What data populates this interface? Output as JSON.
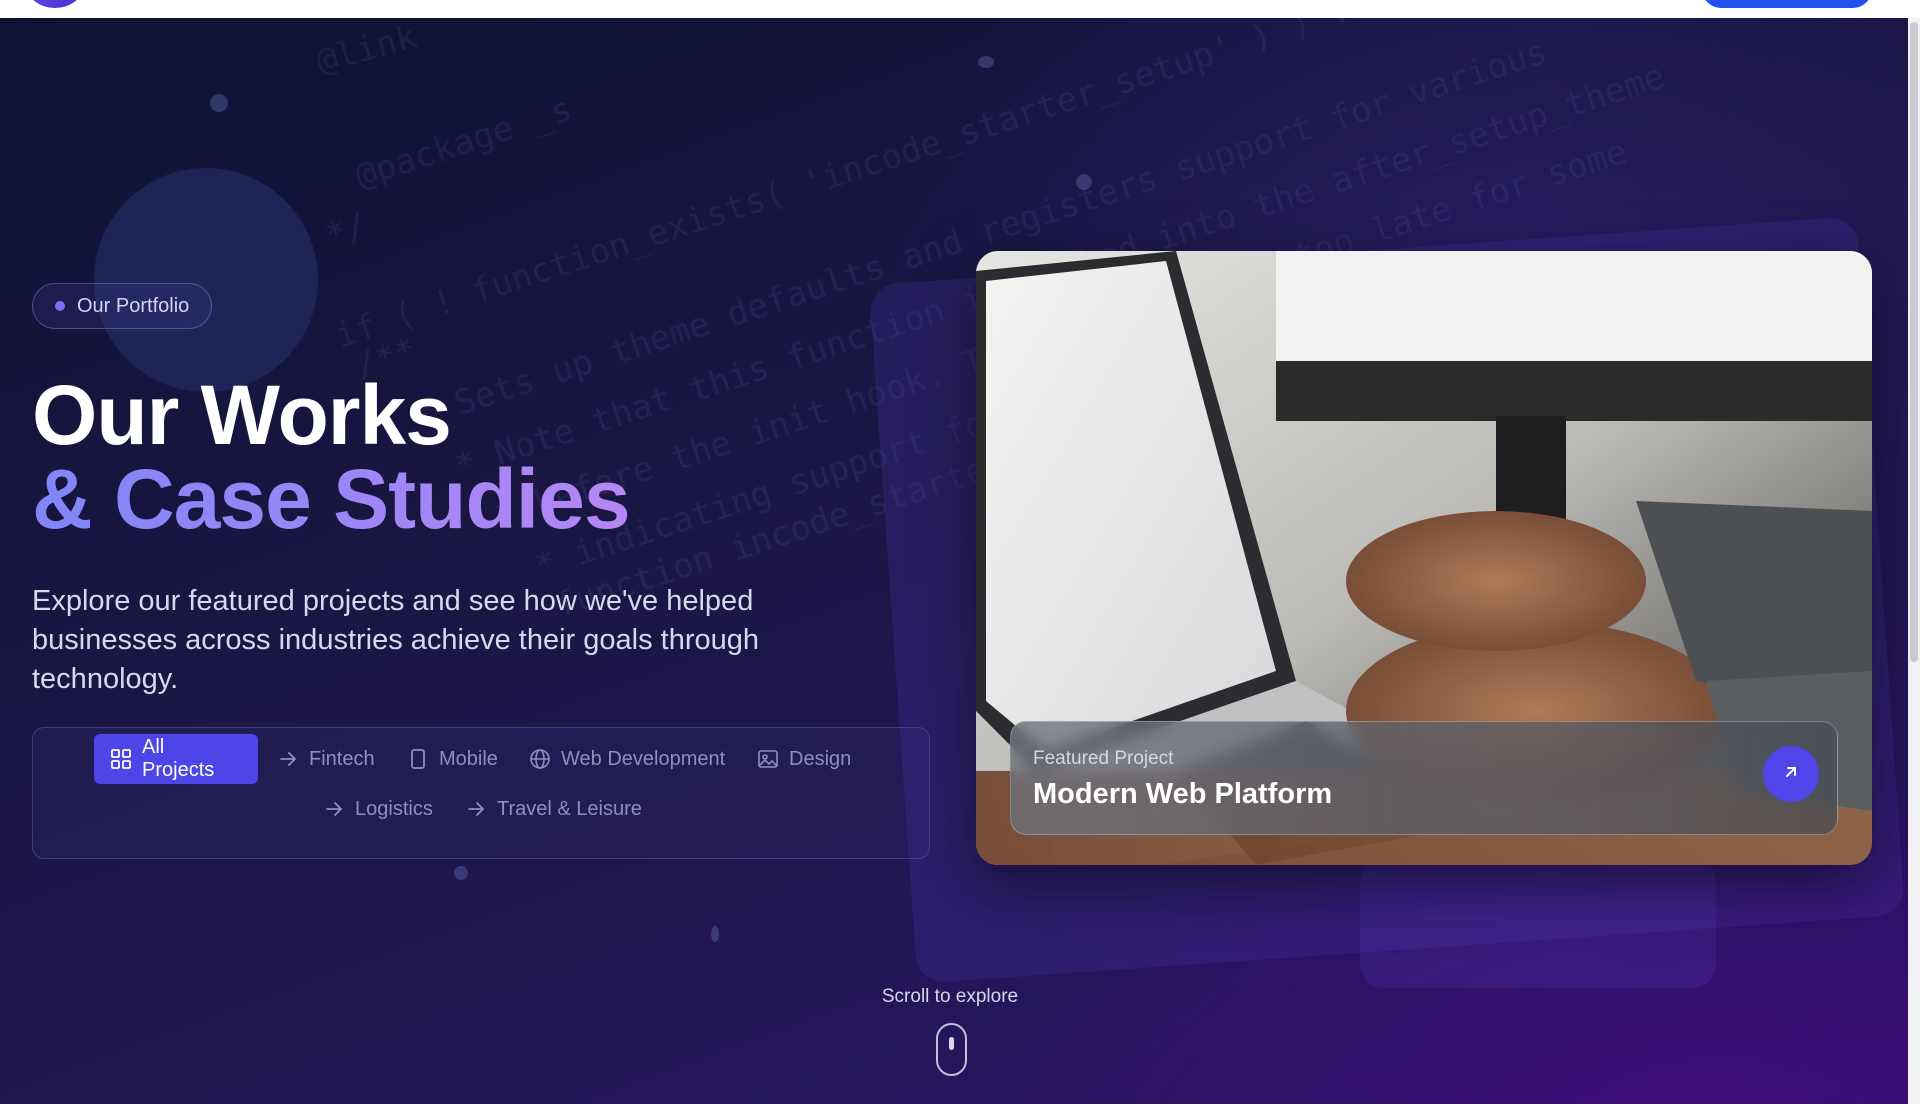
{
  "badge": {
    "label": "Our Portfolio"
  },
  "hero": {
    "title_line1": "Our Works",
    "title_line2": "& Case Studies",
    "description": "Explore our featured projects and see how we've helped businesses across industries achieve their goals through technology."
  },
  "filters": [
    {
      "label": "All Projects",
      "icon": "grid-icon",
      "active": true
    },
    {
      "label": "Fintech",
      "icon": "arrow-right-icon",
      "active": false
    },
    {
      "label": "Mobile",
      "icon": "smartphone-icon",
      "active": false
    },
    {
      "label": "Web Development",
      "icon": "globe-icon",
      "active": false
    },
    {
      "label": "Design",
      "icon": "image-icon",
      "active": false
    },
    {
      "label": "Logistics",
      "icon": "arrow-right-icon",
      "active": false
    },
    {
      "label": "Travel & Leisure",
      "icon": "arrow-right-icon",
      "active": false
    }
  ],
  "featured": {
    "label": "Featured Project",
    "title": "Modern Web Platform",
    "button_icon": "arrow-up-right-icon"
  },
  "scroll": {
    "label": "Scroll to explore",
    "icon": "mouse-icon"
  },
  "code_background": [
    "@link",
    "@package _s",
    "*/",
    "if ( ! function_exists( 'incode_starter_setup' ) ) :",
    "/**",
    "* Sets up theme defaults and registers support for various",
    "* Note that this function is hooked into the after_setup_theme",
    "* before the init hook. The init hook is too late for some",
    "* indicating support for post thumbnails.",
    "function incode_starter_setup"
  ],
  "colors": {
    "accent": "#4c45e8",
    "title_gradient_start": "#7f86f8",
    "title_gradient_end": "#b587f4",
    "background_dark": "#0f1333",
    "background_purple": "#2d1068"
  }
}
